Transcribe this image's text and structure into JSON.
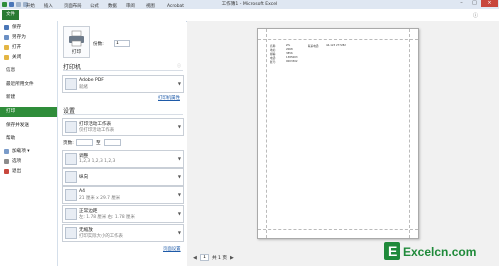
{
  "window": {
    "title": "工作簿1 - Microsoft Excel"
  },
  "ribbon": {
    "file_tab": "文件",
    "tabs": [
      "开始",
      "插入",
      "页面布局",
      "公式",
      "数据",
      "审阅",
      "视图",
      "Acrobat"
    ]
  },
  "nav": {
    "save": "保存",
    "save_as": "另存为",
    "open": "打开",
    "close": "关闭",
    "info": "信息",
    "recent": "最近所用文件",
    "new": "新建",
    "print": "打印",
    "save_send": "保存并发送",
    "help": "帮助",
    "addins": "加载项 ▾",
    "options": "选项",
    "exit": "退出"
  },
  "print": {
    "print_button": "打印",
    "copies_label": "份数:",
    "copies_value": "1",
    "printer_section": "打印机",
    "printer_name": "Adobe PDF",
    "printer_status": "就绪",
    "printer_properties": "打印机属性",
    "settings_section": "设置",
    "what_l1": "打印活动工作表",
    "what_l2": "仅打印活动工作表",
    "pages_label": "页数:",
    "pages_to": "至",
    "collate_l1": "调整",
    "collate_l2": "1,2,3    1,2,3    1,2,3",
    "orientation_l1": "纵向",
    "paper_l1": "A4",
    "paper_l2": "21 厘米 x 29.7 厘米",
    "margins_l1": "正常边距",
    "margins_l2": "左: 1.78 厘米    右: 1.78 厘米",
    "scaling_l1": "无缩放",
    "scaling_l2": "打印实际大小的工作表",
    "page_setup": "页面设置"
  },
  "preview": {
    "page_number": "1",
    "page_total": "共 1 页",
    "rows": [
      {
        "c1": "名称:",
        "c2": "Z%",
        "c3": "联系电话:",
        "c4": "44-123 277282"
      },
      {
        "c1": "地址:",
        "c2": "2068",
        "c3": "",
        "c4": ""
      },
      {
        "c1": "邮编:",
        "c2": "3856",
        "c3": "",
        "c4": ""
      },
      {
        "c1": "电话:",
        "c2": "1385003",
        "c3": "",
        "c4": ""
      },
      {
        "c1": "账号:",
        "c2": "0003302",
        "c3": "",
        "c4": ""
      }
    ],
    "zoom_label": "1"
  },
  "watermark": {
    "text": "Excelcn.com"
  },
  "colors": {
    "accent": "#2f8d3a",
    "title_bg": "#dfe7f2",
    "preview_bg": "#f1f1f1"
  }
}
